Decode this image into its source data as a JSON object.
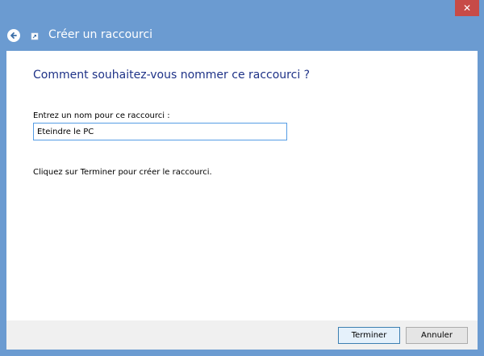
{
  "window": {
    "title": "Créer un raccourci",
    "close_label": "✕"
  },
  "content": {
    "heading": "Comment souhaitez-vous nommer ce raccourci ?",
    "field_label": "Entrez un nom pour ce raccourci :",
    "field_value": "Eteindre le PC",
    "info": "Cliquez sur Terminer pour créer le raccourci."
  },
  "footer": {
    "finish_label": "Terminer",
    "cancel_label": "Annuler"
  },
  "colors": {
    "frame": "#6b9bd1",
    "close": "#c74b47",
    "heading": "#1e3287",
    "input_border": "#569de5",
    "footer_bg": "#f0f0f0"
  }
}
